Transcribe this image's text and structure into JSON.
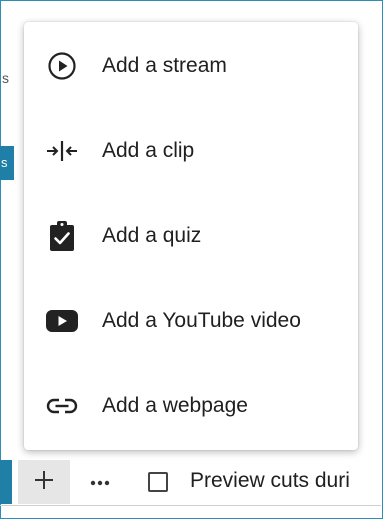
{
  "background_fragments": {
    "left_letter": "s",
    "left_tag": "s"
  },
  "menu": {
    "items": [
      {
        "label": "Add a stream",
        "icon": "play-circle-icon"
      },
      {
        "label": "Add a clip",
        "icon": "clip-trim-icon"
      },
      {
        "label": "Add a quiz",
        "icon": "clipboard-check-icon"
      },
      {
        "label": "Add a YouTube video",
        "icon": "youtube-icon"
      },
      {
        "label": "Add a webpage",
        "icon": "link-icon"
      }
    ]
  },
  "toolbar": {
    "add_icon": "plus-icon",
    "more_icon": "more-horizontal-icon",
    "preview_label": "Preview cuts duri",
    "preview_checked": false
  },
  "colors": {
    "accent": "#1f7fa6",
    "frame": "#2a8fb5",
    "add_button_bg": "#e6e6e6"
  }
}
